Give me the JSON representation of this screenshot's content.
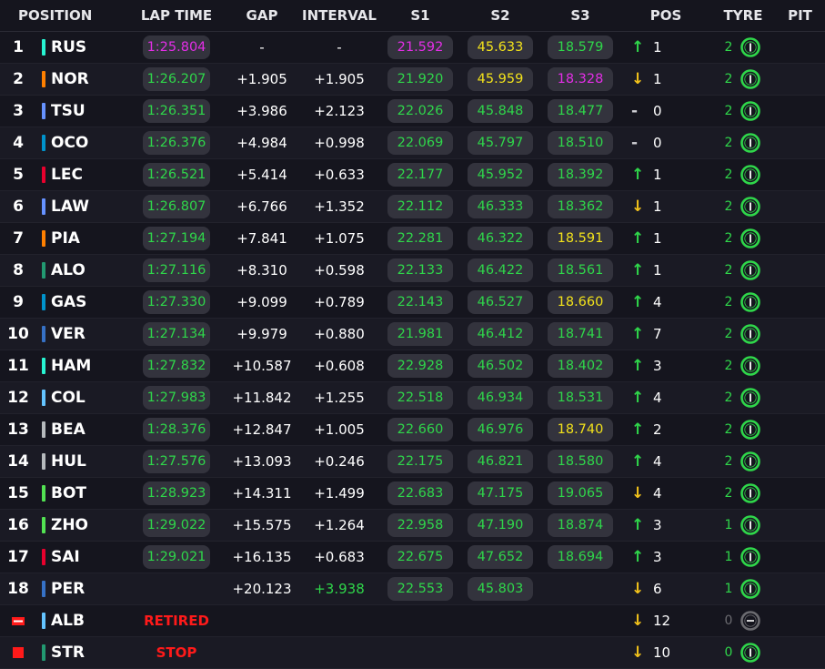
{
  "colors": {
    "purple": "#e32ee6",
    "green": "#2fd64a",
    "yellow": "#f2e21b",
    "white": "#ffffff",
    "retired_red": "#ff1a1a"
  },
  "header": {
    "position": "POSITION",
    "lap_time": "LAP TIME",
    "gap": "GAP",
    "interval": "INTERVAL",
    "s1": "S1",
    "s2": "S2",
    "s3": "S3",
    "pos": "POS",
    "tyre": "TYRE",
    "pit": "PIT"
  },
  "rows": [
    {
      "pos": "1",
      "code": "RUS",
      "team": "#27f4d2",
      "lap": "1:25.804",
      "lapc": "purple",
      "gap": "-",
      "interval": "-",
      "intc": "white",
      "s1": "21.592",
      "s1c": "purple",
      "s2": "45.633",
      "s2c": "yellow",
      "s3": "18.579",
      "s3c": "green",
      "dir": "up",
      "poschange": "1",
      "tyre": "2",
      "tyrec": "#2fd64a",
      "tyreicon": "medium-tyre-icon"
    },
    {
      "pos": "2",
      "code": "NOR",
      "team": "#ff8000",
      "lap": "1:26.207",
      "lapc": "green",
      "gap": "+1.905",
      "interval": "+1.905",
      "intc": "white",
      "s1": "21.920",
      "s1c": "green",
      "s2": "45.959",
      "s2c": "yellow",
      "s3": "18.328",
      "s3c": "purple",
      "dir": "down",
      "poschange": "1",
      "tyre": "2",
      "tyrec": "#2fd64a",
      "tyreicon": "medium-tyre-icon"
    },
    {
      "pos": "3",
      "code": "TSU",
      "team": "#6692ff",
      "lap": "1:26.351",
      "lapc": "green",
      "gap": "+3.986",
      "interval": "+2.123",
      "intc": "white",
      "s1": "22.026",
      "s1c": "green",
      "s2": "45.848",
      "s2c": "green",
      "s3": "18.477",
      "s3c": "green",
      "dir": "flat",
      "poschange": "0",
      "tyre": "2",
      "tyrec": "#2fd64a",
      "tyreicon": "medium-tyre-icon"
    },
    {
      "pos": "4",
      "code": "OCO",
      "team": "#0093cc",
      "lap": "1:26.376",
      "lapc": "green",
      "gap": "+4.984",
      "interval": "+0.998",
      "intc": "white",
      "s1": "22.069",
      "s1c": "green",
      "s2": "45.797",
      "s2c": "green",
      "s3": "18.510",
      "s3c": "green",
      "dir": "flat",
      "poschange": "0",
      "tyre": "2",
      "tyrec": "#2fd64a",
      "tyreicon": "medium-tyre-icon"
    },
    {
      "pos": "5",
      "code": "LEC",
      "team": "#e8002d",
      "lap": "1:26.521",
      "lapc": "green",
      "gap": "+5.414",
      "interval": "+0.633",
      "intc": "white",
      "s1": "22.177",
      "s1c": "green",
      "s2": "45.952",
      "s2c": "green",
      "s3": "18.392",
      "s3c": "green",
      "dir": "up",
      "poschange": "1",
      "tyre": "2",
      "tyrec": "#2fd64a",
      "tyreicon": "medium-tyre-icon"
    },
    {
      "pos": "6",
      "code": "LAW",
      "team": "#6692ff",
      "lap": "1:26.807",
      "lapc": "green",
      "gap": "+6.766",
      "interval": "+1.352",
      "intc": "white",
      "s1": "22.112",
      "s1c": "green",
      "s2": "46.333",
      "s2c": "green",
      "s3": "18.362",
      "s3c": "green",
      "dir": "down",
      "poschange": "1",
      "tyre": "2",
      "tyrec": "#2fd64a",
      "tyreicon": "medium-tyre-icon"
    },
    {
      "pos": "7",
      "code": "PIA",
      "team": "#ff8000",
      "lap": "1:27.194",
      "lapc": "green",
      "gap": "+7.841",
      "interval": "+1.075",
      "intc": "white",
      "s1": "22.281",
      "s1c": "green",
      "s2": "46.322",
      "s2c": "green",
      "s3": "18.591",
      "s3c": "yellow",
      "dir": "up",
      "poschange": "1",
      "tyre": "2",
      "tyrec": "#2fd64a",
      "tyreicon": "medium-tyre-icon"
    },
    {
      "pos": "8",
      "code": "ALO",
      "team": "#229971",
      "lap": "1:27.116",
      "lapc": "green",
      "gap": "+8.310",
      "interval": "+0.598",
      "intc": "white",
      "s1": "22.133",
      "s1c": "green",
      "s2": "46.422",
      "s2c": "green",
      "s3": "18.561",
      "s3c": "green",
      "dir": "up",
      "poschange": "1",
      "tyre": "2",
      "tyrec": "#2fd64a",
      "tyreicon": "medium-tyre-icon"
    },
    {
      "pos": "9",
      "code": "GAS",
      "team": "#0093cc",
      "lap": "1:27.330",
      "lapc": "green",
      "gap": "+9.099",
      "interval": "+0.789",
      "intc": "white",
      "s1": "22.143",
      "s1c": "green",
      "s2": "46.527",
      "s2c": "green",
      "s3": "18.660",
      "s3c": "yellow",
      "dir": "up",
      "poschange": "4",
      "tyre": "2",
      "tyrec": "#2fd64a",
      "tyreicon": "medium-tyre-icon"
    },
    {
      "pos": "10",
      "code": "VER",
      "team": "#3671c6",
      "lap": "1:27.134",
      "lapc": "green",
      "gap": "+9.979",
      "interval": "+0.880",
      "intc": "white",
      "s1": "21.981",
      "s1c": "green",
      "s2": "46.412",
      "s2c": "green",
      "s3": "18.741",
      "s3c": "green",
      "dir": "up",
      "poschange": "7",
      "tyre": "2",
      "tyrec": "#2fd64a",
      "tyreicon": "medium-tyre-icon"
    },
    {
      "pos": "11",
      "code": "HAM",
      "team": "#27f4d2",
      "lap": "1:27.832",
      "lapc": "green",
      "gap": "+10.587",
      "interval": "+0.608",
      "intc": "white",
      "s1": "22.928",
      "s1c": "green",
      "s2": "46.502",
      "s2c": "green",
      "s3": "18.402",
      "s3c": "green",
      "dir": "up",
      "poschange": "3",
      "tyre": "2",
      "tyrec": "#2fd64a",
      "tyreicon": "medium-tyre-icon"
    },
    {
      "pos": "12",
      "code": "COL",
      "team": "#64c4ff",
      "lap": "1:27.983",
      "lapc": "green",
      "gap": "+11.842",
      "interval": "+1.255",
      "intc": "white",
      "s1": "22.518",
      "s1c": "green",
      "s2": "46.934",
      "s2c": "green",
      "s3": "18.531",
      "s3c": "green",
      "dir": "up",
      "poschange": "4",
      "tyre": "2",
      "tyrec": "#2fd64a",
      "tyreicon": "medium-tyre-icon"
    },
    {
      "pos": "13",
      "code": "BEA",
      "team": "#b6babd",
      "lap": "1:28.376",
      "lapc": "green",
      "gap": "+12.847",
      "interval": "+1.005",
      "intc": "white",
      "s1": "22.660",
      "s1c": "green",
      "s2": "46.976",
      "s2c": "green",
      "s3": "18.740",
      "s3c": "yellow",
      "dir": "up",
      "poschange": "2",
      "tyre": "2",
      "tyrec": "#2fd64a",
      "tyreicon": "medium-tyre-icon"
    },
    {
      "pos": "14",
      "code": "HUL",
      "team": "#b6babd",
      "lap": "1:27.576",
      "lapc": "green",
      "gap": "+13.093",
      "interval": "+0.246",
      "intc": "white",
      "s1": "22.175",
      "s1c": "green",
      "s2": "46.821",
      "s2c": "green",
      "s3": "18.580",
      "s3c": "green",
      "dir": "up",
      "poschange": "4",
      "tyre": "2",
      "tyrec": "#2fd64a",
      "tyreicon": "medium-tyre-icon"
    },
    {
      "pos": "15",
      "code": "BOT",
      "team": "#52e252",
      "lap": "1:28.923",
      "lapc": "green",
      "gap": "+14.311",
      "interval": "+1.499",
      "intc": "white",
      "s1": "22.683",
      "s1c": "green",
      "s2": "47.175",
      "s2c": "green",
      "s3": "19.065",
      "s3c": "green",
      "dir": "down",
      "poschange": "4",
      "tyre": "2",
      "tyrec": "#2fd64a",
      "tyreicon": "medium-tyre-icon"
    },
    {
      "pos": "16",
      "code": "ZHO",
      "team": "#52e252",
      "lap": "1:29.022",
      "lapc": "green",
      "gap": "+15.575",
      "interval": "+1.264",
      "intc": "white",
      "s1": "22.958",
      "s1c": "green",
      "s2": "47.190",
      "s2c": "green",
      "s3": "18.874",
      "s3c": "green",
      "dir": "up",
      "poschange": "3",
      "tyre": "1",
      "tyrec": "#2fd64a",
      "tyreicon": "medium-tyre-icon"
    },
    {
      "pos": "17",
      "code": "SAI",
      "team": "#e8002d",
      "lap": "1:29.021",
      "lapc": "green",
      "gap": "+16.135",
      "interval": "+0.683",
      "intc": "white",
      "s1": "22.675",
      "s1c": "green",
      "s2": "47.652",
      "s2c": "green",
      "s3": "18.694",
      "s3c": "green",
      "dir": "up",
      "poschange": "3",
      "tyre": "1",
      "tyrec": "#2fd64a",
      "tyreicon": "medium-tyre-icon"
    },
    {
      "pos": "18",
      "code": "PER",
      "team": "#3671c6",
      "lap": "",
      "lapc": "green",
      "gap": "+20.123",
      "interval": "+3.938",
      "intc": "green",
      "s1": "22.553",
      "s1c": "green",
      "s2": "45.803",
      "s2c": "green",
      "s3": "",
      "s3c": "green",
      "dir": "down",
      "poschange": "6",
      "tyre": "1",
      "tyrec": "#2fd64a",
      "tyreicon": "medium-tyre-icon"
    },
    {
      "pos": "",
      "posflag": "retired",
      "code": "ALB",
      "team": "#64c4ff",
      "status": "RETIRED",
      "lap": "",
      "gap": "",
      "interval": "",
      "s1": "",
      "s2": "",
      "s3": "",
      "dir": "down",
      "poschange": "12",
      "tyre": "0",
      "tyrec": "#6b6b70",
      "tyreicon": "tyre-inactive-icon"
    },
    {
      "pos": "",
      "posflag": "stop",
      "code": "STR",
      "team": "#229971",
      "status": "STOP",
      "lap": "",
      "gap": "",
      "interval": "",
      "s1": "",
      "s2": "",
      "s3": "",
      "dir": "down",
      "poschange": "10",
      "tyre": "0",
      "tyrec": "#2fd64a",
      "tyreicon": "medium-tyre-icon"
    }
  ]
}
